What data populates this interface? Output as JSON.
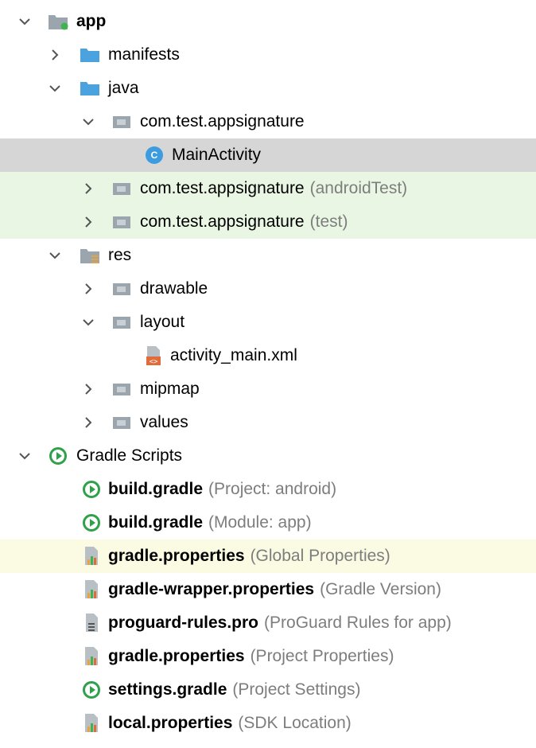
{
  "tree": {
    "app": {
      "label": "app"
    },
    "manifests": {
      "label": "manifests"
    },
    "java": {
      "label": "java"
    },
    "pkg_main": {
      "label": "com.test.appsignature"
    },
    "main_activity": {
      "label": "MainActivity",
      "badge": "C"
    },
    "pkg_android_test": {
      "label": "com.test.appsignature",
      "hint": "(androidTest)"
    },
    "pkg_test": {
      "label": "com.test.appsignature",
      "hint": "(test)"
    },
    "res": {
      "label": "res"
    },
    "drawable": {
      "label": "drawable"
    },
    "layout": {
      "label": "layout"
    },
    "activity_main": {
      "label": "activity_main.xml"
    },
    "mipmap": {
      "label": "mipmap"
    },
    "values": {
      "label": "values"
    },
    "gradle_scripts": {
      "label": "Gradle Scripts"
    },
    "build_gradle_project": {
      "label": "build.gradle",
      "hint": "(Project: android)"
    },
    "build_gradle_module": {
      "label": "build.gradle",
      "hint": "(Module: app)"
    },
    "gradle_props_global": {
      "label": "gradle.properties",
      "hint": "(Global Properties)"
    },
    "gradle_wrapper_props": {
      "label": "gradle-wrapper.properties",
      "hint": "(Gradle Version)"
    },
    "proguard_rules": {
      "label": "proguard-rules.pro",
      "hint": "(ProGuard Rules for app)"
    },
    "gradle_props_project": {
      "label": "gradle.properties",
      "hint": "(Project Properties)"
    },
    "settings_gradle": {
      "label": "settings.gradle",
      "hint": "(Project Settings)"
    },
    "local_props": {
      "label": "local.properties",
      "hint": "(SDK Location)"
    }
  },
  "colors": {
    "selected_row": "#d6d6d6",
    "test_row": "#eaf6e4",
    "highlight_row": "#fbfbe3",
    "folder_blue": "#4aa3df",
    "package_gray": "#9aa5ad",
    "gradle_green": "#2fa14a",
    "class_badge": "#3d9be0",
    "hint_gray": "#7d7d7d"
  }
}
